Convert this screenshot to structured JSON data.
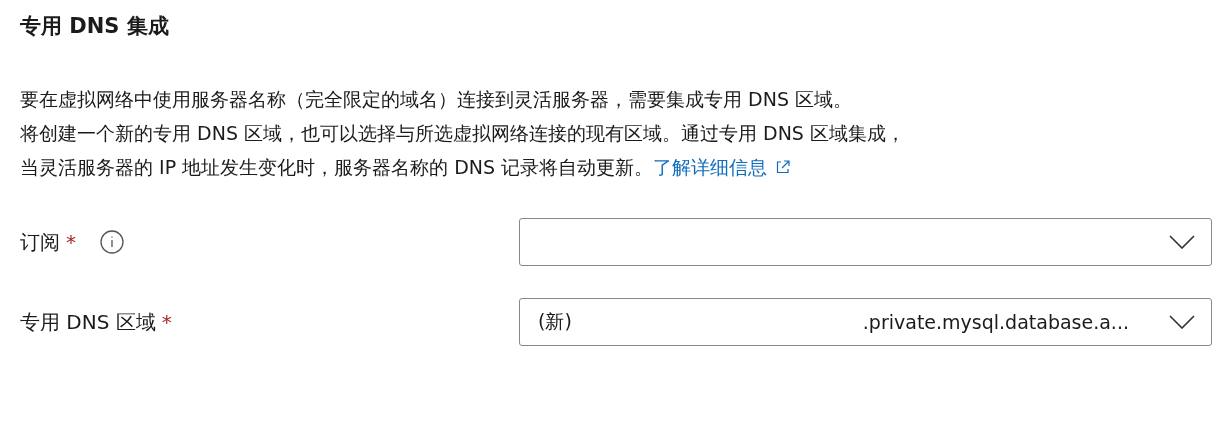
{
  "section": {
    "title": "专用 DNS 集成",
    "description_lines": [
      "要在虚拟网络中使用服务器名称（完全限定的域名）连接到灵活服务器，需要集成专用 DNS 区域。",
      "将创建一个新的专用 DNS 区域，也可以选择与所选虚拟网络连接的现有区域。通过专用 DNS 区域集成，",
      "当灵活服务器的 IP 地址发生变化时，服务器名称的 DNS 记录将自动更新。"
    ],
    "link": "了解详细信息"
  },
  "fields": [
    {
      "label": "订阅",
      "required_mark": "*",
      "info": true
    },
    {
      "label": "专用 DNS 区域",
      "required_mark": "*",
      "prefix": "(新)",
      "value": ".private.mysql.database.a..."
    }
  ]
}
